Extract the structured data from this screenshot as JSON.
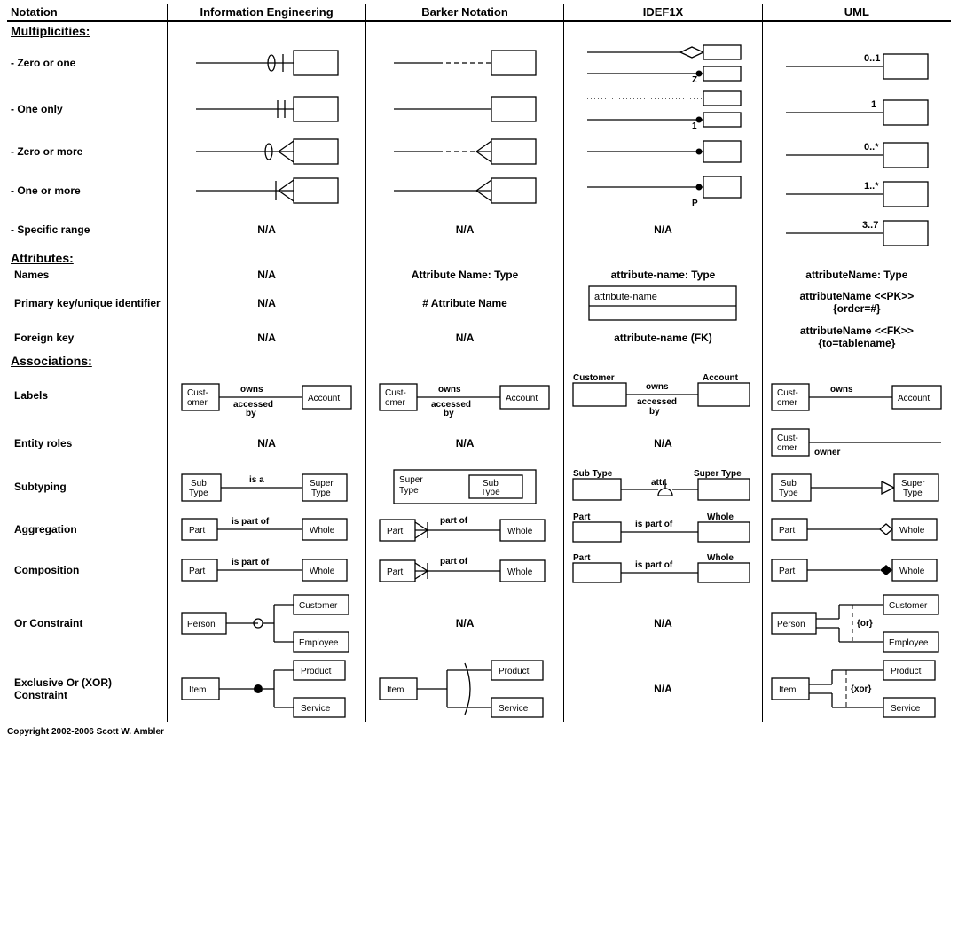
{
  "headers": {
    "c0": "Notation",
    "c1": "Information Engineering",
    "c2": "Barker Notation",
    "c3": "IDEF1X",
    "c4": "UML"
  },
  "sections": {
    "multiplicities": "Multiplicities:",
    "attributes": "Attributes:",
    "associations": "Associations:"
  },
  "rows": {
    "zero_or_one": "- Zero or one",
    "one_only": "- One only",
    "zero_or_more": "- Zero or more",
    "one_or_more": "- One or more",
    "specific_range": "- Specific range",
    "names": "Names",
    "pk": "Primary key/unique identifier",
    "fk": "Foreign key",
    "labels": "Labels",
    "entity_roles": "Entity roles",
    "subtyping": "Subtyping",
    "aggregation": "Aggregation",
    "composition": "Composition",
    "or": "Or Constraint",
    "xor": "Exclusive Or (XOR) Constraint"
  },
  "na": "N/A",
  "uml_mult": {
    "zero_or_one": "0..1",
    "one_only": "1",
    "zero_or_more": "0..*",
    "one_or_more": "1..*",
    "specific_range": "3..7"
  },
  "idef1x_mult": {
    "zero_or_one": "Z",
    "one_only": "1",
    "one_or_more": "P"
  },
  "attr": {
    "barker_names": "Attribute Name: Type",
    "idef1x_names": "attribute-name: Type",
    "uml_names": "attributeName: Type",
    "barker_pk": "# Attribute Name",
    "idef1x_pk": "attribute-name",
    "uml_pk_l1": "attributeName <<PK>>",
    "uml_pk_l2": "{order=#}",
    "idef1x_fk": "attribute-name (FK)",
    "uml_fk_l1": "attributeName <<FK>>",
    "uml_fk_l2": "{to=tablename}"
  },
  "assoc": {
    "customer": "Customer",
    "cust1": "Cust-",
    "cust2": "omer",
    "account": "Account",
    "owns": "owns",
    "accessed": "accessed",
    "by": "by",
    "owner": "owner",
    "sub": "Sub",
    "type": "Type",
    "super": "Super",
    "is_a": "is a",
    "attr": "attr.",
    "subtype": "Sub Type",
    "supertype": "Super Type",
    "part": "Part",
    "whole": "Whole",
    "is_part_of": "is part of",
    "part_of": "part of",
    "person": "Person",
    "employee": "Employee",
    "or": "{or}",
    "item": "Item",
    "product": "Product",
    "service": "Service",
    "xor": "{xor}"
  },
  "copyright": "Copyright 2002-2006 Scott W. Ambler"
}
